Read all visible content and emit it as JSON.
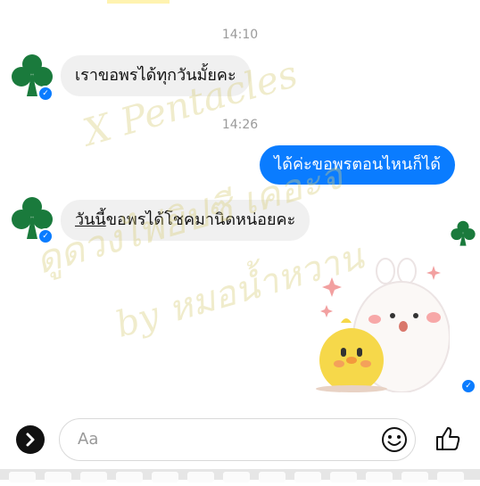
{
  "timestamps": [
    "14:10",
    "14:26"
  ],
  "messages": [
    {
      "from": "other",
      "text": "เราขอพรได้ทุกวันมั้ยคะ"
    },
    {
      "from": "me",
      "text": "ได้ค่ะขอพรตอนไหนก็ได้"
    },
    {
      "from": "other",
      "text_underlined": "วันนี้",
      "text_rest": "ขอพรได้โชคมานิดหน่อยคะ"
    }
  ],
  "watermark": {
    "line1": "X Pentacles",
    "line2": "ดูดวงไพ่ยิปซี เคอะจ",
    "line3": "by หมอน้ำหวาน"
  },
  "composer": {
    "placeholder": "Aa"
  },
  "icons": {
    "avatar": "club-suit-icon",
    "seen": "check-circle-icon",
    "expand": "chevron-right-icon",
    "emoji": "smiley-icon",
    "like": "thumbs-up-icon"
  },
  "colors": {
    "accent": "#0a7cff",
    "club": "#1a7a3c",
    "bubble_in": "#f0f0f0"
  }
}
